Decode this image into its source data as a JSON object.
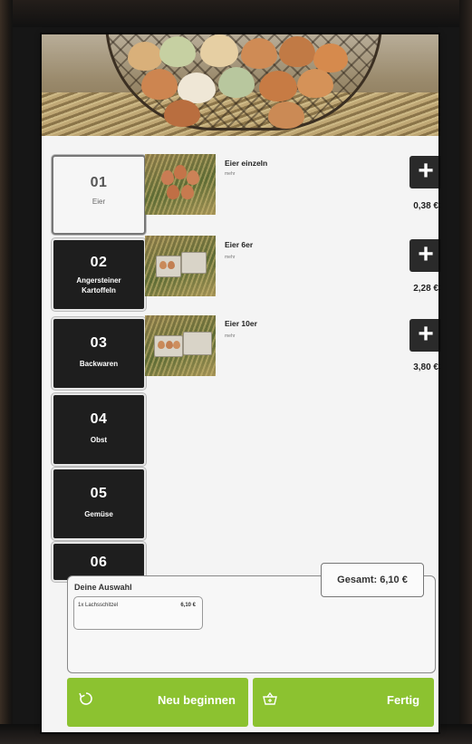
{
  "categories": [
    {
      "number": "01",
      "name": "Eier",
      "active": true
    },
    {
      "number": "02",
      "name": "Angersteiner Kartoffeln",
      "active": false
    },
    {
      "number": "03",
      "name": "Backwaren",
      "active": false
    },
    {
      "number": "04",
      "name": "Obst",
      "active": false
    },
    {
      "number": "05",
      "name": "Gemüse",
      "active": false
    },
    {
      "number": "06",
      "name": "",
      "active": false
    }
  ],
  "products": [
    {
      "name": "Eier einzeln",
      "subtitle": "mehr",
      "add_label": "+",
      "price": "0,38 €"
    },
    {
      "name": "Eier 6er",
      "subtitle": "mehr",
      "add_label": "+",
      "price": "2,28 €"
    },
    {
      "name": "Eier 10er",
      "subtitle": "mehr",
      "add_label": "+",
      "price": "3,80 €"
    }
  ],
  "selection": {
    "title": "Deine Auswahl",
    "items": [
      {
        "name": "1x Lachsschitzel",
        "price": "6,10 €"
      }
    ]
  },
  "total": "Gesamt: 6,10 €",
  "buttons": {
    "restart": {
      "label": "Neu beginnen",
      "icon": "refresh-icon"
    },
    "done": {
      "label": "Fertig",
      "icon": "basket-icon"
    }
  },
  "colors": {
    "accent": "#8cc230",
    "dark_tile": "#1e1e1e"
  }
}
